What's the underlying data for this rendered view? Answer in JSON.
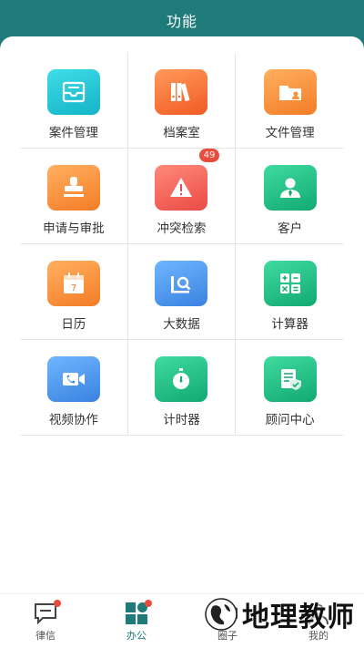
{
  "header": {
    "title": "功能"
  },
  "features": [
    {
      "label": "案件管理",
      "icon": "inbox-tray-icon",
      "color": "#1ec4d4"
    },
    {
      "label": "档案室",
      "icon": "archive-binders-icon",
      "color": "#f36f34"
    },
    {
      "label": "文件管理",
      "icon": "folder-user-icon",
      "color": "#f7913a"
    },
    {
      "label": "申请与审批",
      "icon": "stamp-icon",
      "color": "#f7913a",
      "badge": "49"
    },
    {
      "label": "冲突检索",
      "icon": "warning-document-icon",
      "color": "#f0605a"
    },
    {
      "label": "客户",
      "icon": "client-user-icon",
      "color": "#22c08a"
    },
    {
      "label": "日历",
      "icon": "calendar-icon",
      "color": "#f7913a",
      "calendar_day": "7"
    },
    {
      "label": "大数据",
      "icon": "big-data-search-icon",
      "color": "#4b98ea"
    },
    {
      "label": "计算器",
      "icon": "calculator-icon",
      "color": "#22c08a"
    },
    {
      "label": "视频协作",
      "icon": "video-camera-icon",
      "color": "#4b98ea"
    },
    {
      "label": "计时器",
      "icon": "timer-icon",
      "color": "#22c08a"
    },
    {
      "label": "顾问中心",
      "icon": "consultant-shield-icon",
      "color": "#22c08a"
    }
  ],
  "tabbar": {
    "items": [
      {
        "label": "律信",
        "icon": "chat-icon"
      },
      {
        "label": "办公",
        "icon": "office-grid-icon"
      },
      {
        "label": "圈子",
        "icon": "circle-hexagon-icon"
      },
      {
        "label": "我的",
        "icon": "profile-icon"
      }
    ],
    "active_color": "#1f7a7a"
  },
  "watermark": {
    "text": "地理教师"
  }
}
